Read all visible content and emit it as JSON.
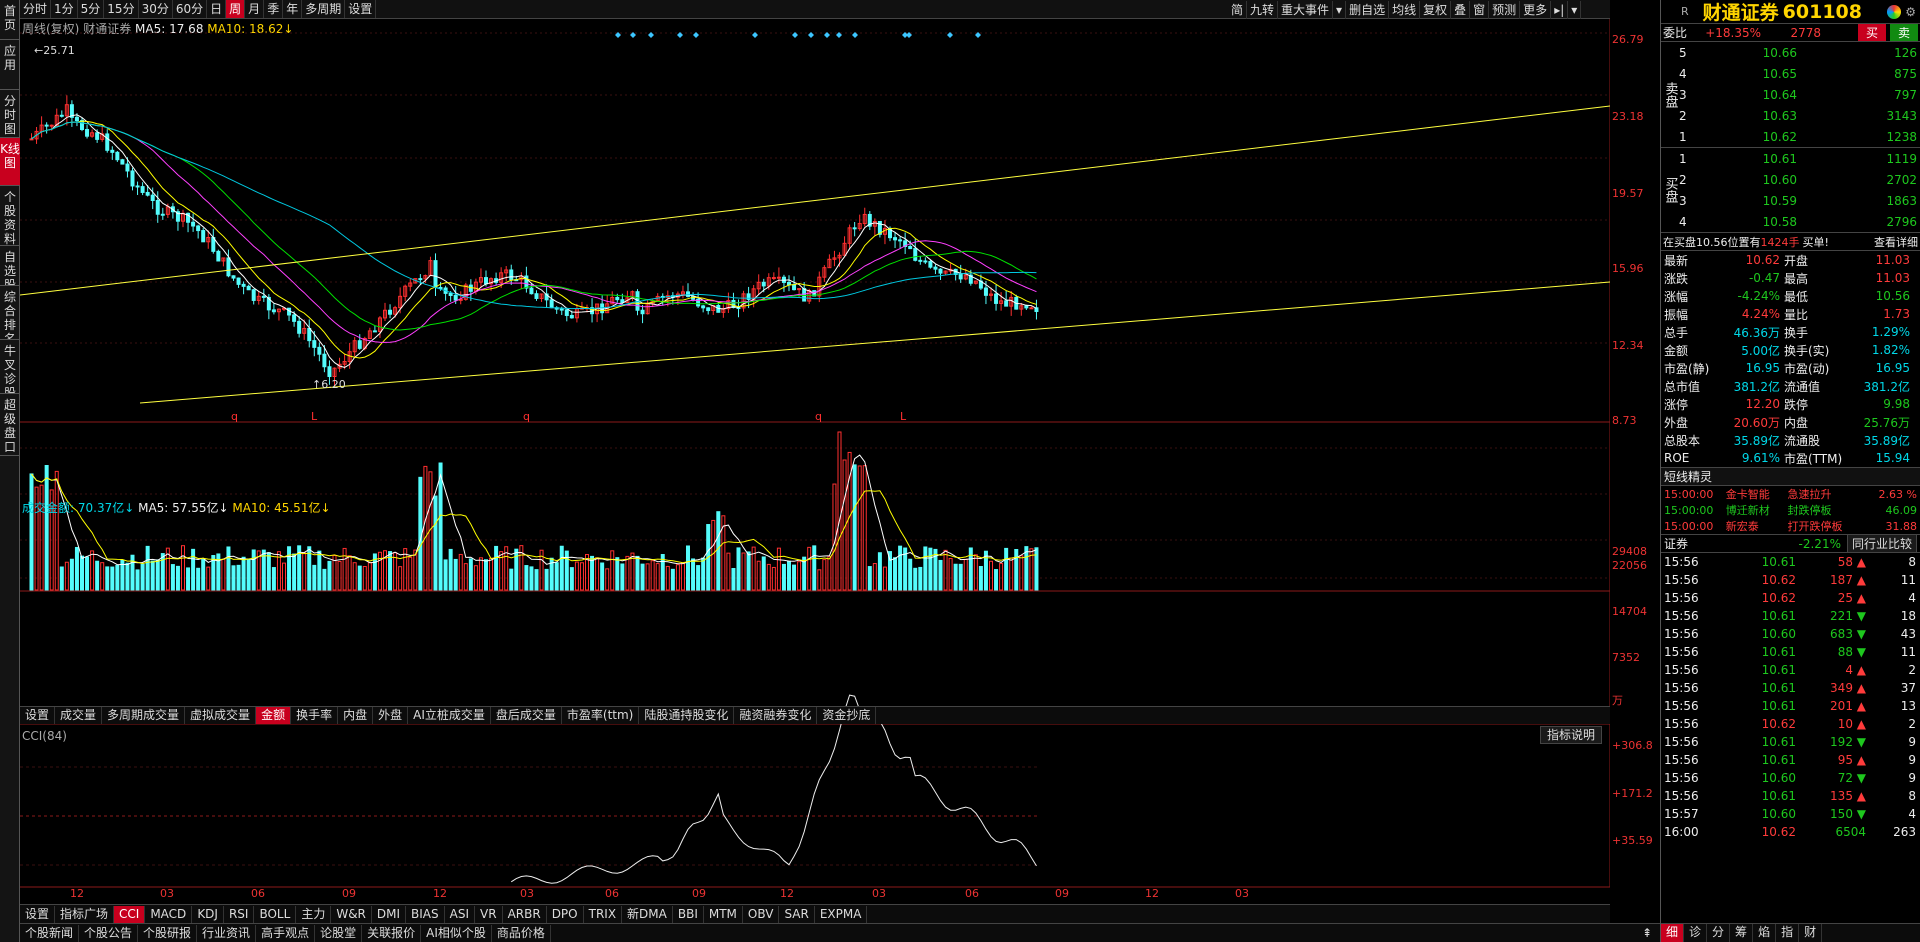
{
  "left_sidebar": [
    "首页",
    "应用",
    "分时图",
    "K线图",
    "个股资料",
    "自选股",
    "综合排名",
    "牛叉诊股",
    "超级盘口"
  ],
  "top_bar": {
    "periods": [
      "分时",
      "1分",
      "5分",
      "15分",
      "30分",
      "60分",
      "日",
      "周",
      "月",
      "季",
      "年",
      "多周期",
      "设置"
    ],
    "active_period": "周",
    "right_tools": [
      "简",
      "九转",
      "重大事件",
      "▾",
      "删自选",
      "均线",
      "复权",
      "叠",
      "窗",
      "预测",
      "更多",
      "▸|",
      "▾"
    ]
  },
  "main_chart": {
    "legend": {
      "mode": "周线(复权)",
      "name": "财通证券",
      "ma5": "MA5: 17.68",
      "ma10": "MA10: 18.62↓"
    },
    "price_axis": [
      "26.79",
      "23.18",
      "19.57",
      "15.96",
      "12.34",
      "8.73"
    ],
    "high_label": "25.71",
    "low_label": "6.20",
    "event_markers": [
      "q",
      "L",
      "q",
      "q",
      "L"
    ]
  },
  "volume_chart": {
    "legend": {
      "name": "成交金额: 70.37亿↓",
      "ma5": "MA5: 57.55亿↓",
      "ma10": "MA10: 45.51亿↓"
    },
    "axis": [
      "29408",
      "22056",
      "14704",
      "7352",
      "万"
    ]
  },
  "volume_tabs": [
    "设置",
    "成交量",
    "多周期成交量",
    "虚拟成交量",
    "金额",
    "换手率",
    "内盘",
    "外盘",
    "AI立桩成交量",
    "盘后成交量",
    "市盈率(ttm)",
    "陆股通持股变化",
    "融资融券变化",
    "资金抄底"
  ],
  "volume_tab_active": "金额",
  "indicator": {
    "title": "CCI(84)",
    "explain_btn": "指标说明",
    "axis": [
      "+306.8",
      "+171.2",
      "+35.59"
    ]
  },
  "time_axis": [
    "12",
    "03",
    "06",
    "09",
    "12",
    "03",
    "06",
    "09",
    "12",
    "03",
    "06",
    "09",
    "12",
    "03"
  ],
  "indicator_tabs": [
    "设置",
    "指标广场",
    "CCI",
    "MACD",
    "KDJ",
    "RSI",
    "BOLL",
    "主力",
    "W&R",
    "DMI",
    "BIAS",
    "ASI",
    "VR",
    "ARBR",
    "DPO",
    "TRIX",
    "新DMA",
    "BBI",
    "MTM",
    "OBV",
    "SAR",
    "EXPMA"
  ],
  "indicator_tab_active": "CCI",
  "bottom_tabs": [
    "个股新闻",
    "个股公告",
    "个股研报",
    "行业资讯",
    "高手观点",
    "论股堂",
    "关联报价",
    "AI相似个股",
    "商品价格"
  ],
  "quote": {
    "r_mark": "R",
    "name": "财通证券",
    "code": "601108",
    "weibi_label": "委比",
    "weibi": "+18.35%",
    "weicha": "2778",
    "buy_btn": "买",
    "sell_btn": "卖",
    "sell_label": "卖盘",
    "buy_label": "买盘",
    "asks": [
      [
        "5",
        "10.66",
        "126"
      ],
      [
        "4",
        "10.65",
        "875"
      ],
      [
        "3",
        "10.64",
        "797"
      ],
      [
        "2",
        "10.63",
        "3143"
      ],
      [
        "1",
        "10.62",
        "1238"
      ]
    ],
    "bids": [
      [
        "1",
        "10.61",
        "1119"
      ],
      [
        "2",
        "10.60",
        "2702"
      ],
      [
        "3",
        "10.59",
        "1863"
      ],
      [
        "4",
        "10.58",
        "2796"
      ]
    ],
    "notice": "在买盘10.56位置有",
    "notice_num": "1424手",
    "notice_tail": "买单!",
    "notice_link": "查看详细",
    "stats": [
      [
        "最新",
        "10.62",
        "开盘",
        "11.03"
      ],
      [
        "涨跌",
        "-0.47",
        "最高",
        "11.03"
      ],
      [
        "涨幅",
        "-4.24%",
        "最低",
        "10.56"
      ],
      [
        "振幅",
        "4.24%",
        "量比",
        "1.73"
      ],
      [
        "总手",
        "46.36万",
        "换手",
        "1.29%"
      ],
      [
        "金额",
        "5.00亿",
        "换手(实)",
        "1.82%"
      ],
      [
        "市盈(静)",
        "16.95",
        "市盈(动)",
        "16.95"
      ],
      [
        "总市值",
        "381.2亿",
        "流通值",
        "381.2亿"
      ],
      [
        "涨停",
        "12.20",
        "跌停",
        "9.98"
      ],
      [
        "外盘",
        "20.60万",
        "内盘",
        "25.76万"
      ],
      [
        "总股本",
        "35.89亿",
        "流通股",
        "35.89亿"
      ],
      [
        "ROE",
        "9.61%",
        "市盈(TTM)",
        "15.94"
      ]
    ],
    "short_title": "短线精灵",
    "short_items": [
      [
        "15:00:00",
        "金卡智能",
        "急速拉升",
        "2.63 %"
      ],
      [
        "15:00:00",
        "博迁新材",
        "封跌停板",
        "46.09"
      ],
      [
        "15:00:00",
        "新宏泰",
        "打开跌停板",
        "31.88"
      ]
    ],
    "industry": "证券",
    "industry_pct": "-2.21%",
    "industry_btn": "同行业比较",
    "ticks": [
      [
        "15:56",
        "10.61",
        "58",
        "8"
      ],
      [
        "15:56",
        "10.62",
        "187",
        "11"
      ],
      [
        "15:56",
        "10.62",
        "25",
        "4"
      ],
      [
        "15:56",
        "10.61",
        "221",
        "18"
      ],
      [
        "15:56",
        "10.60",
        "683",
        "43"
      ],
      [
        "15:56",
        "10.61",
        "88",
        "11"
      ],
      [
        "15:56",
        "10.61",
        "4",
        "2"
      ],
      [
        "15:56",
        "10.61",
        "349",
        "37"
      ],
      [
        "15:56",
        "10.61",
        "201",
        "13"
      ],
      [
        "15:56",
        "10.62",
        "10",
        "2"
      ],
      [
        "15:56",
        "10.61",
        "192",
        "9"
      ],
      [
        "15:56",
        "10.61",
        "95",
        "9"
      ],
      [
        "15:56",
        "10.60",
        "72",
        "9"
      ],
      [
        "15:56",
        "10.61",
        "135",
        "8"
      ],
      [
        "15:57",
        "10.60",
        "150",
        "4"
      ],
      [
        "16:00",
        "10.62",
        "6504",
        "263"
      ]
    ],
    "bottom_tabs": [
      "细",
      "诊",
      "分",
      "筹",
      "焰",
      "指",
      "财"
    ]
  }
}
